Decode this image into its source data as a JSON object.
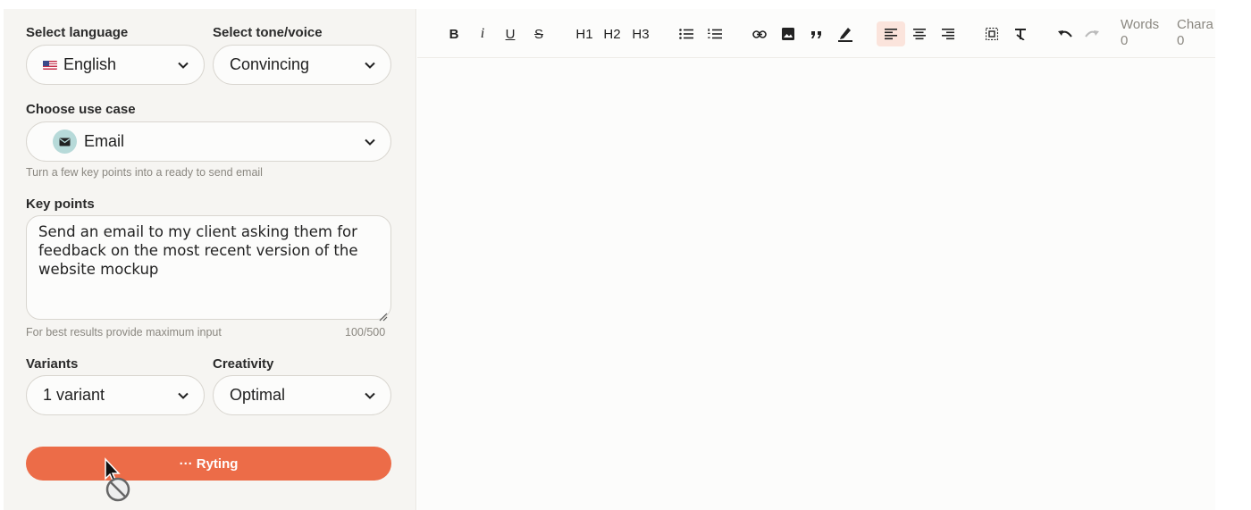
{
  "settings": {
    "language": {
      "label": "Select language",
      "value": "English",
      "flag_icon": "us-flag-icon"
    },
    "tone": {
      "label": "Select tone/voice",
      "value": "Convincing"
    },
    "use_case": {
      "label": "Choose use case",
      "value": "Email",
      "icon": "envelope-icon",
      "description": "Turn a few key points into a ready to send email"
    },
    "key_points": {
      "label": "Key points",
      "value": "Send an email to my client asking them for feedback on the most recent version of the website mockup",
      "hint": "For best results provide maximum input",
      "counter": "100/500"
    },
    "variants": {
      "label": "Variants",
      "value": "1 variant"
    },
    "creativity": {
      "label": "Creativity",
      "value": "Optimal"
    },
    "generate_button": {
      "label": "··· Ryting"
    }
  },
  "toolbar": {
    "bold": "B",
    "italic": "i",
    "underline": "U",
    "strike": "S",
    "h1": "H1",
    "h2": "H2",
    "h3": "H3",
    "words_label": "Words",
    "words_value": "0",
    "chars_label": "Chara",
    "chars_value": "0"
  },
  "colors": {
    "accent": "#ec6c48",
    "panel_bg": "#f6f5f2",
    "active_tool_bg": "#fbe4dc",
    "usecase_icon_bg": "#b7dad9"
  }
}
